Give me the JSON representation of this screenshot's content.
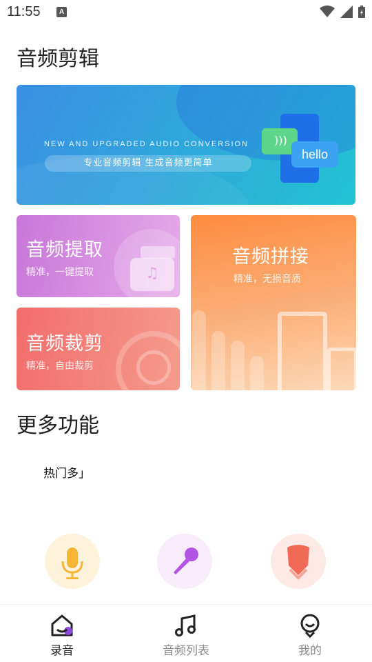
{
  "status_bar": {
    "time": "11:55",
    "notification_icon": "a-letter-icon"
  },
  "header": {
    "title": "音频剪辑"
  },
  "banner": {
    "headline": "NEW AND UPGRADED AUDIO CONVERSION",
    "tagline": "专业音频剪辑   生成音频更简单",
    "bubble_text": "hello"
  },
  "cards": {
    "extract": {
      "title": "音频提取",
      "subtitle": "精准，一键提取"
    },
    "cut": {
      "title": "音频裁剪",
      "subtitle": "精准，自由裁剪"
    },
    "join": {
      "title": "音频拼接",
      "subtitle": "精准，无损音质"
    }
  },
  "more": {
    "title": "更多功能",
    "hot_label": "热门多」"
  },
  "tools": [
    {
      "icon": "microphone-icon"
    },
    {
      "icon": "karaoke-mic-icon"
    },
    {
      "icon": "shield-icon"
    }
  ],
  "tabbar": {
    "items": [
      {
        "label": "录音",
        "icon": "home-icon"
      },
      {
        "label": "音频列表",
        "icon": "music-note-icon"
      },
      {
        "label": "我的",
        "icon": "profile-icon"
      }
    ]
  },
  "colors": {
    "accent": "#8a4bd8",
    "tab_active": "#222222",
    "tab_inactive": "#888888"
  }
}
